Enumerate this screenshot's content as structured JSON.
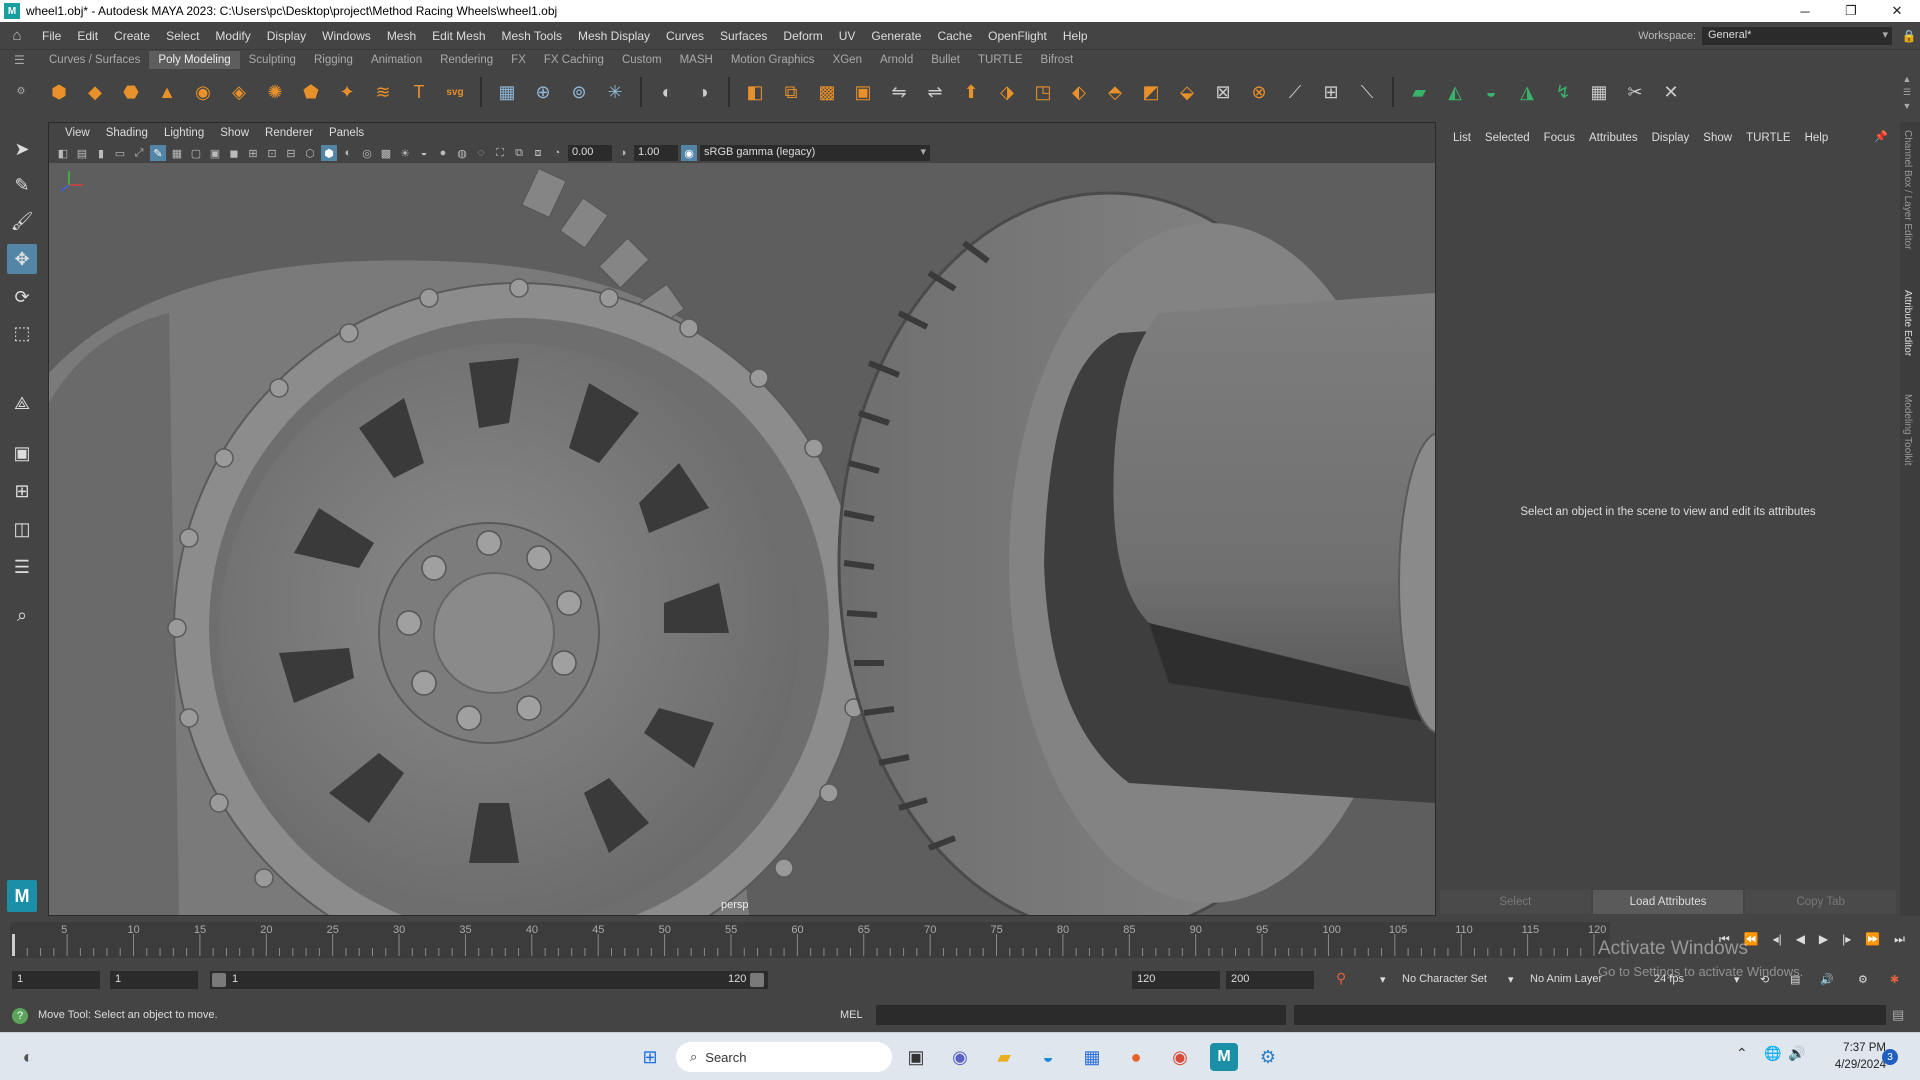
{
  "window": {
    "title": "wheel1.obj* - Autodesk MAYA 2023: C:\\Users\\pc\\Desktop\\project\\Method Racing Wheels\\wheel1.obj",
    "icon_letter": "M",
    "minimize": "─",
    "restore": "❐",
    "close": "✕"
  },
  "menubar": {
    "items": [
      "File",
      "Edit",
      "Create",
      "Select",
      "Modify",
      "Display",
      "Windows",
      "Mesh",
      "Edit Mesh",
      "Mesh Tools",
      "Mesh Display",
      "Curves",
      "Surfaces",
      "Deform",
      "UV",
      "Generate",
      "Cache",
      "OpenFlight",
      "Help"
    ],
    "workspace_label": "Workspace:",
    "workspace_value": "General*"
  },
  "shelf": {
    "tabs": [
      "Curves / Surfaces",
      "Poly Modeling",
      "Sculpting",
      "Rigging",
      "Animation",
      "Rendering",
      "FX",
      "FX Caching",
      "Custom",
      "MASH",
      "Motion Graphics",
      "XGen",
      "Arnold",
      "Bullet",
      "TURTLE",
      "Bifrost"
    ],
    "active_tab": "Poly Modeling",
    "icons": [
      {
        "name": "sphere-icon",
        "glyph": "⬢",
        "color": "#e8902a"
      },
      {
        "name": "cube-icon",
        "glyph": "◆",
        "color": "#e8902a"
      },
      {
        "name": "cylinder-icon",
        "glyph": "⬣",
        "color": "#e8902a"
      },
      {
        "name": "cone-icon",
        "glyph": "▲",
        "color": "#e8902a"
      },
      {
        "name": "torus-icon",
        "glyph": "◉",
        "color": "#e8902a"
      },
      {
        "name": "plane-icon",
        "glyph": "◈",
        "color": "#e8902a"
      },
      {
        "name": "disc-icon",
        "glyph": "✺",
        "color": "#e8902a"
      },
      {
        "name": "platonic-icon",
        "glyph": "⬟",
        "color": "#e8902a"
      },
      {
        "name": "super-shape-icon",
        "glyph": "✦",
        "color": "#e8902a"
      },
      {
        "name": "sweep-icon",
        "glyph": "≋",
        "color": "#e8902a"
      },
      {
        "name": "type-icon",
        "glyph": "T",
        "color": "#e8902a"
      },
      {
        "name": "svg-icon",
        "glyph": "svg",
        "color": "#e8902a"
      },
      {
        "name": "uv-editor-icon",
        "glyph": "▦",
        "color": "#8fb8d8"
      },
      {
        "name": "measure-icon",
        "glyph": "⊕",
        "color": "#8fb8d8"
      },
      {
        "name": "snap-icon",
        "glyph": "⊚",
        "color": "#8fb8d8"
      },
      {
        "name": "center-pivot-icon",
        "glyph": "✳",
        "color": "#8fb8d8"
      },
      {
        "name": "combine-icon",
        "glyph": "◐",
        "color": "#cccccc"
      },
      {
        "name": "separate-icon",
        "glyph": "◑",
        "color": "#cccccc"
      },
      {
        "name": "extract-icon",
        "glyph": "◧",
        "color": "#e8902a"
      },
      {
        "name": "boolean-icon",
        "glyph": "⧉",
        "color": "#e8902a"
      },
      {
        "name": "smooth-icon",
        "glyph": "▩",
        "color": "#e8902a"
      },
      {
        "name": "reduce-icon",
        "glyph": "▣",
        "color": "#e8902a"
      },
      {
        "name": "mirror-icon",
        "glyph": "⇋",
        "color": "#cccccc"
      },
      {
        "name": "bridge-icon",
        "glyph": "⇌",
        "color": "#cccccc"
      },
      {
        "name": "extrude-icon",
        "glyph": "⬆",
        "color": "#e8902a"
      },
      {
        "name": "bevel-icon",
        "glyph": "⬗",
        "color": "#e8902a"
      },
      {
        "name": "fill-hole-icon",
        "glyph": "◳",
        "color": "#e8902a"
      },
      {
        "name": "merge-icon",
        "glyph": "⬖",
        "color": "#e8902a"
      },
      {
        "name": "append-icon",
        "glyph": "⬘",
        "color": "#e8902a"
      },
      {
        "name": "multi-cut-icon",
        "glyph": "◩",
        "color": "#e8902a"
      },
      {
        "name": "target-weld-icon",
        "glyph": "⬙",
        "color": "#e8902a"
      },
      {
        "name": "connect-icon",
        "glyph": "⊠",
        "color": "#cccccc"
      },
      {
        "name": "collapse-icon",
        "glyph": "⊗",
        "color": "#e8902a"
      },
      {
        "name": "edit-edge-flow-icon",
        "glyph": "⟋",
        "color": "#cccccc"
      },
      {
        "name": "slide-edge-icon",
        "glyph": "⊞",
        "color": "#cccccc"
      },
      {
        "name": "quad-draw-icon",
        "glyph": "⟍",
        "color": "#cccccc"
      },
      {
        "name": "planar-uv-icon",
        "glyph": "▰",
        "color": "#3ab36a"
      },
      {
        "name": "cylindrical-uv-icon",
        "glyph": "◭",
        "color": "#3ab36a"
      },
      {
        "name": "spherical-uv-icon",
        "glyph": "◒",
        "color": "#3ab36a"
      },
      {
        "name": "auto-uv-icon",
        "glyph": "◮",
        "color": "#3ab36a"
      },
      {
        "name": "unfold-uv-icon",
        "glyph": "↯",
        "color": "#3ab36a"
      },
      {
        "name": "layout-uv-icon",
        "glyph": "▦",
        "color": "#cccccc"
      },
      {
        "name": "cut-uv-icon",
        "glyph": "✂",
        "color": "#cccccc"
      },
      {
        "name": "sew-uv-icon",
        "glyph": "✕",
        "color": "#cccccc"
      }
    ]
  },
  "viewport": {
    "menu": [
      "View",
      "Shading",
      "Lighting",
      "Show",
      "Renderer",
      "Panels"
    ],
    "exposure": "0.00",
    "gamma": "1.00",
    "color_space": "sRGB gamma (legacy)",
    "camera_label": "persp"
  },
  "attribute_editor": {
    "menu": [
      "List",
      "Selected",
      "Focus",
      "Attributes",
      "Display",
      "Show",
      "TURTLE",
      "Help"
    ],
    "message": "Select an object in the scene to view and edit its attributes",
    "buttons": [
      "Select",
      "Load Attributes",
      "Copy Tab"
    ]
  },
  "side_tabs": [
    "Channel Box / Layer Editor",
    "Attribute Editor",
    "Modeling Toolkit"
  ],
  "timeline": {
    "ticks": [
      5,
      10,
      15,
      20,
      25,
      30,
      35,
      40,
      45,
      50,
      55,
      60,
      65,
      70,
      75,
      80,
      85,
      90,
      95,
      100,
      105,
      110,
      115,
      120
    ],
    "current_frame": "0",
    "start": 1,
    "end": 120
  },
  "range": {
    "start_time": "1",
    "playback_start": "1",
    "range_start_label": "1",
    "range_end_label": "120",
    "playback_end": "120",
    "end_time": "200",
    "character_set": "No Character Set",
    "anim_layer": "No Anim Layer",
    "fps": "24 fps"
  },
  "windows_watermark": {
    "line1": "Activate Windows",
    "line2": "Go to Settings to activate Windows."
  },
  "command_line": {
    "help_text": "Move Tool: Select an object to move.",
    "language": "MEL"
  },
  "taskbar": {
    "search_placeholder": "Search",
    "time": "7:37 PM",
    "date": "4/29/2024",
    "notification_count": "3"
  }
}
